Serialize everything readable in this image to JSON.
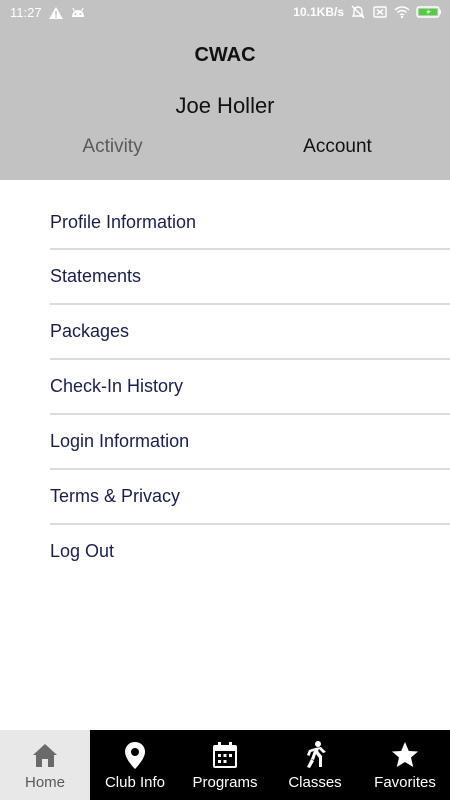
{
  "status_bar": {
    "time": "11:27",
    "network_speed": "10.1KB/s",
    "left_icons": [
      "warning-icon",
      "android-icon"
    ],
    "right_icons": [
      "alarm-off-icon",
      "sim-off-icon",
      "wifi-icon",
      "battery-charging-icon"
    ]
  },
  "header": {
    "app_title": "CWAC",
    "user_name": "Joe Holler",
    "background_color": "#c2c2c2"
  },
  "tabs": [
    {
      "label": "Activity",
      "selected": false
    },
    {
      "label": "Account",
      "selected": true
    }
  ],
  "menu": {
    "items": [
      {
        "label": "Profile Information"
      },
      {
        "label": "Statements"
      },
      {
        "label": "Packages"
      },
      {
        "label": "Check-In History"
      },
      {
        "label": "Login Information"
      },
      {
        "label": "Terms & Privacy"
      },
      {
        "label": "Log Out"
      }
    ],
    "text_color": "#1a1f4f"
  },
  "bottom_nav": {
    "items": [
      {
        "label": "Home",
        "icon": "home-icon",
        "active": true
      },
      {
        "label": "Club Info",
        "icon": "location-pin-icon",
        "active": false
      },
      {
        "label": "Programs",
        "icon": "calendar-icon",
        "active": false
      },
      {
        "label": "Classes",
        "icon": "running-person-icon",
        "active": false
      },
      {
        "label": "Favorites",
        "icon": "star-icon",
        "active": false
      }
    ],
    "background_color": "#000000",
    "active_background_color": "#e8e8e8"
  }
}
